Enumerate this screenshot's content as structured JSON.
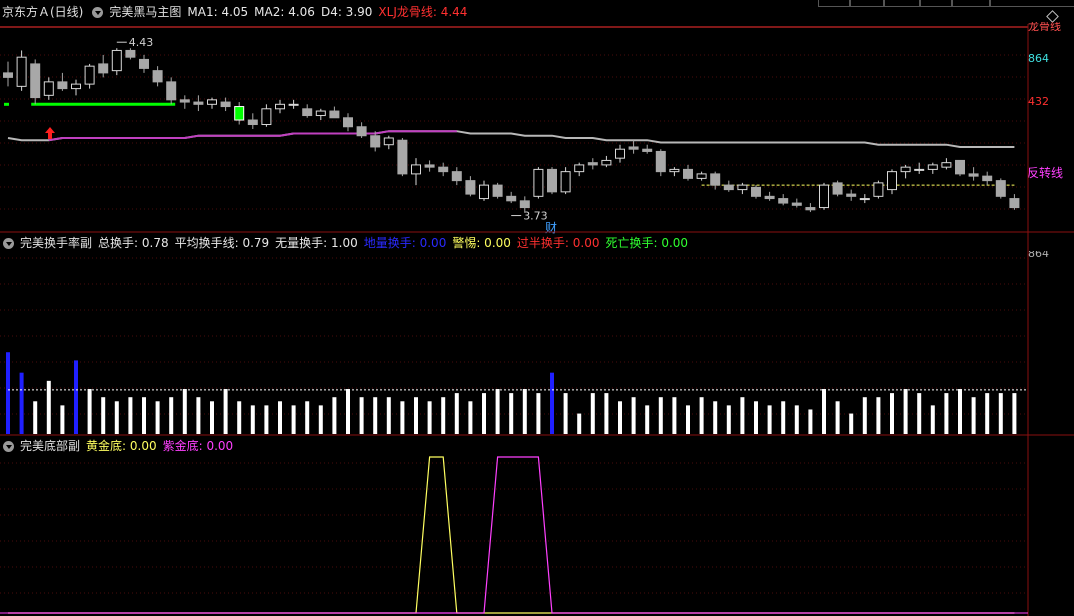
{
  "header": {
    "stock": "京东方Ａ(日线)",
    "indicator": "完美黑马主图",
    "ma1": "MA1: 4.05",
    "ma2": "MA2: 4.06",
    "d4": "D4: 3.90",
    "xlj": "XLJ龙骨线: 4.44"
  },
  "turnover_panel": {
    "name": "完美换手率副",
    "total": "总换手: 0.78",
    "avg": "平均换手线: 0.79",
    "none_vol": "无量换手: 1.00",
    "ground": "地量换手: 0.00",
    "alert": "警惕: 0.00",
    "over": "过半换手: 0.00",
    "death": "死亡换手: 0.00"
  },
  "bottom_panel": {
    "name": "完美底部副",
    "gold": "黄金底: 0.00",
    "purple": "紫金底: 0.00"
  },
  "axis_labels": {
    "top_cut": "龙骨线",
    "v864": "864",
    "v432": "432",
    "sub864": "864"
  },
  "annotations": {
    "high": "4.43",
    "low": "3.73",
    "cai": "财",
    "reversal": "反转线"
  },
  "colors": {
    "up": "#000000",
    "down": "#a8a8a8",
    "bull_stroke": "#d8d8d8",
    "xlj": "#b8b8b8",
    "gold": "#ffff60",
    "purple": "#ff40ff",
    "ground": "#2020ff",
    "axis_cyan": "#40e0e0",
    "axis_red": "#ff3030",
    "green_line": "#00ff00"
  },
  "chart_data": [
    {
      "type": "candlestick",
      "title": "完美黑马主图",
      "candles": [
        [
          4.32,
          4.37,
          4.26,
          4.3
        ],
        [
          4.26,
          4.42,
          4.24,
          4.39
        ],
        [
          4.36,
          4.38,
          4.18,
          4.21
        ],
        [
          4.22,
          4.3,
          4.2,
          4.28
        ],
        [
          4.28,
          4.32,
          4.24,
          4.25
        ],
        [
          4.25,
          4.29,
          4.22,
          4.27
        ],
        [
          4.27,
          4.36,
          4.25,
          4.35
        ],
        [
          4.36,
          4.4,
          4.3,
          4.32
        ],
        [
          4.33,
          4.43,
          4.31,
          4.42
        ],
        [
          4.42,
          4.43,
          4.38,
          4.39
        ],
        [
          4.38,
          4.4,
          4.32,
          4.34
        ],
        [
          4.33,
          4.35,
          4.26,
          4.28
        ],
        [
          4.28,
          4.3,
          4.18,
          4.2
        ],
        [
          4.2,
          4.22,
          4.16,
          4.19
        ],
        [
          4.19,
          4.22,
          4.15,
          4.18
        ],
        [
          4.18,
          4.21,
          4.16,
          4.2
        ],
        [
          4.19,
          4.21,
          4.15,
          4.17
        ],
        [
          4.17,
          4.19,
          4.09,
          4.11
        ],
        [
          4.11,
          4.14,
          4.07,
          4.09
        ],
        [
          4.09,
          4.18,
          4.08,
          4.16
        ],
        [
          4.16,
          4.2,
          4.14,
          4.18
        ],
        [
          4.18,
          4.2,
          4.16,
          4.18
        ],
        [
          4.16,
          4.18,
          4.12,
          4.13
        ],
        [
          4.13,
          4.16,
          4.11,
          4.15
        ],
        [
          4.15,
          4.17,
          4.12,
          4.12
        ],
        [
          4.12,
          4.14,
          4.06,
          4.08
        ],
        [
          4.08,
          4.1,
          4.03,
          4.04
        ],
        [
          4.04,
          4.06,
          3.97,
          3.99
        ],
        [
          4.0,
          4.04,
          3.98,
          4.03
        ],
        [
          4.02,
          4.03,
          3.86,
          3.87
        ],
        [
          3.87,
          3.94,
          3.82,
          3.91
        ],
        [
          3.91,
          3.93,
          3.88,
          3.9
        ],
        [
          3.9,
          3.92,
          3.86,
          3.88
        ],
        [
          3.88,
          3.9,
          3.82,
          3.84
        ],
        [
          3.84,
          3.86,
          3.77,
          3.78
        ],
        [
          3.76,
          3.84,
          3.75,
          3.82
        ],
        [
          3.82,
          3.83,
          3.76,
          3.77
        ],
        [
          3.77,
          3.79,
          3.74,
          3.75
        ],
        [
          3.75,
          3.77,
          3.7,
          3.72
        ],
        [
          3.77,
          3.9,
          3.76,
          3.89
        ],
        [
          3.89,
          3.9,
          3.78,
          3.79
        ],
        [
          3.79,
          3.9,
          3.78,
          3.88
        ],
        [
          3.88,
          3.92,
          3.86,
          3.91
        ],
        [
          3.92,
          3.94,
          3.89,
          3.91
        ],
        [
          3.91,
          3.95,
          3.9,
          3.93
        ],
        [
          3.94,
          4.0,
          3.92,
          3.98
        ],
        [
          3.99,
          4.02,
          3.96,
          3.98
        ],
        [
          3.98,
          4.0,
          3.96,
          3.97
        ],
        [
          3.97,
          3.98,
          3.86,
          3.88
        ],
        [
          3.88,
          3.9,
          3.86,
          3.89
        ],
        [
          3.89,
          3.91,
          3.84,
          3.85
        ],
        [
          3.85,
          3.88,
          3.84,
          3.87
        ],
        [
          3.87,
          3.88,
          3.8,
          3.82
        ],
        [
          3.82,
          3.84,
          3.79,
          3.8
        ],
        [
          3.8,
          3.83,
          3.78,
          3.82
        ],
        [
          3.81,
          3.82,
          3.76,
          3.77
        ],
        [
          3.77,
          3.79,
          3.75,
          3.76
        ],
        [
          3.76,
          3.78,
          3.73,
          3.74
        ],
        [
          3.74,
          3.76,
          3.72,
          3.73
        ],
        [
          3.72,
          3.74,
          3.7,
          3.71
        ],
        [
          3.72,
          3.83,
          3.71,
          3.82
        ],
        [
          3.83,
          3.84,
          3.77,
          3.78
        ],
        [
          3.78,
          3.8,
          3.75,
          3.77
        ],
        [
          3.76,
          3.78,
          3.74,
          3.76
        ],
        [
          3.77,
          3.84,
          3.76,
          3.83
        ],
        [
          3.8,
          3.89,
          3.78,
          3.88
        ],
        [
          3.88,
          3.91,
          3.85,
          3.9
        ],
        [
          3.89,
          3.92,
          3.87,
          3.89
        ],
        [
          3.89,
          3.92,
          3.87,
          3.91
        ],
        [
          3.9,
          3.94,
          3.89,
          3.92
        ],
        [
          3.93,
          3.93,
          3.86,
          3.87
        ],
        [
          3.87,
          3.9,
          3.84,
          3.86
        ],
        [
          3.86,
          3.88,
          3.82,
          3.84
        ],
        [
          3.84,
          3.85,
          3.76,
          3.77
        ],
        [
          3.76,
          3.78,
          3.71,
          3.72
        ]
      ],
      "xlj_line": [
        4.03,
        4.02,
        4.02,
        4.02,
        4.03,
        4.03,
        4.03,
        4.03,
        4.03,
        4.03,
        4.03,
        4.03,
        4.03,
        4.03,
        4.04,
        4.04,
        4.04,
        4.04,
        4.04,
        4.04,
        4.04,
        4.05,
        4.05,
        4.05,
        4.05,
        4.05,
        4.05,
        4.05,
        4.06,
        4.06,
        4.06,
        4.06,
        4.06,
        4.06,
        4.05,
        4.05,
        4.05,
        4.05,
        4.04,
        4.04,
        4.04,
        4.03,
        4.03,
        4.03,
        4.02,
        4.02,
        4.02,
        4.02,
        4.01,
        4.01,
        4.01,
        4.01,
        4.01,
        4.01,
        4.01,
        4.01,
        4.01,
        4.01,
        4.01,
        4.01,
        4.01,
        4.01,
        4.01,
        4.01,
        4.0,
        4.0,
        4.0,
        4.0,
        4.0,
        4.0,
        3.99,
        3.99,
        3.99,
        3.99,
        3.99
      ],
      "green_line_indices": [
        2,
        12
      ],
      "green_line_value": 4.18,
      "yellow_dash": {
        "from": 51,
        "to": 74,
        "value": 3.82
      },
      "annotations": [
        {
          "index": 8,
          "value": 4.43,
          "text": "4.43"
        },
        {
          "index": 37,
          "value": 3.72,
          "text": "3.73"
        }
      ],
      "ylim": [
        3.62,
        4.52
      ]
    },
    {
      "type": "bar",
      "title": "完美换手率副",
      "values": [
        2.0,
        1.5,
        0.8,
        1.3,
        0.7,
        1.8,
        1.1,
        0.9,
        0.8,
        0.9,
        0.9,
        0.8,
        0.9,
        1.1,
        0.9,
        0.8,
        1.1,
        0.8,
        0.7,
        0.7,
        0.8,
        0.7,
        0.8,
        0.7,
        0.9,
        1.1,
        0.9,
        0.9,
        0.9,
        0.8,
        0.9,
        0.8,
        0.9,
        1.0,
        0.8,
        1.0,
        1.1,
        1.0,
        1.1,
        1.0,
        1.5,
        1.0,
        0.5,
        1.0,
        1.0,
        0.8,
        0.9,
        0.7,
        0.9,
        0.9,
        0.7,
        0.9,
        0.8,
        0.7,
        0.9,
        0.8,
        0.7,
        0.8,
        0.7,
        0.6,
        1.1,
        0.8,
        0.5,
        0.9,
        0.9,
        1.0,
        1.1,
        1.0,
        0.7,
        1.0,
        1.1,
        0.9,
        1.0,
        1.0,
        1.0
      ],
      "ground_indices": [
        0,
        1,
        5,
        40
      ],
      "avg_line": 1.08,
      "ylim": [
        0,
        4.5
      ]
    },
    {
      "type": "line",
      "title": "完美底部副",
      "series": [
        {
          "name": "黄金底",
          "color": "#ffff60",
          "values": [
            0,
            0,
            0,
            0,
            0,
            0,
            0,
            0,
            0,
            0,
            0,
            0,
            0,
            0,
            0,
            0,
            0,
            0,
            0,
            0,
            0,
            0,
            0,
            0,
            0,
            0,
            0,
            0,
            0,
            0,
            0,
            1,
            1,
            0,
            0,
            0,
            0,
            0,
            0,
            0,
            0,
            0,
            0,
            0,
            0,
            0,
            0,
            0,
            0,
            0,
            0,
            0,
            0,
            0,
            0,
            0,
            0,
            0,
            0,
            0,
            0,
            0,
            0,
            0,
            0,
            0,
            0,
            0,
            0,
            0,
            0,
            0,
            0,
            0,
            0
          ]
        },
        {
          "name": "紫金底",
          "color": "#ff40ff",
          "values": [
            0,
            0,
            0,
            0,
            0,
            0,
            0,
            0,
            0,
            0,
            0,
            0,
            0,
            0,
            0,
            0,
            0,
            0,
            0,
            0,
            0,
            0,
            0,
            0,
            0,
            0,
            0,
            0,
            0,
            0,
            0,
            0,
            0,
            0,
            0,
            0,
            1,
            1,
            1,
            1,
            0,
            0,
            0,
            0,
            0,
            0,
            0,
            0,
            0,
            0,
            0,
            0,
            0,
            0,
            0,
            0,
            0,
            0,
            0,
            0,
            0,
            0,
            0,
            0,
            0,
            0,
            0,
            0,
            0,
            0,
            0,
            0,
            0,
            0,
            0
          ]
        }
      ],
      "ylim": [
        0,
        1
      ]
    }
  ]
}
